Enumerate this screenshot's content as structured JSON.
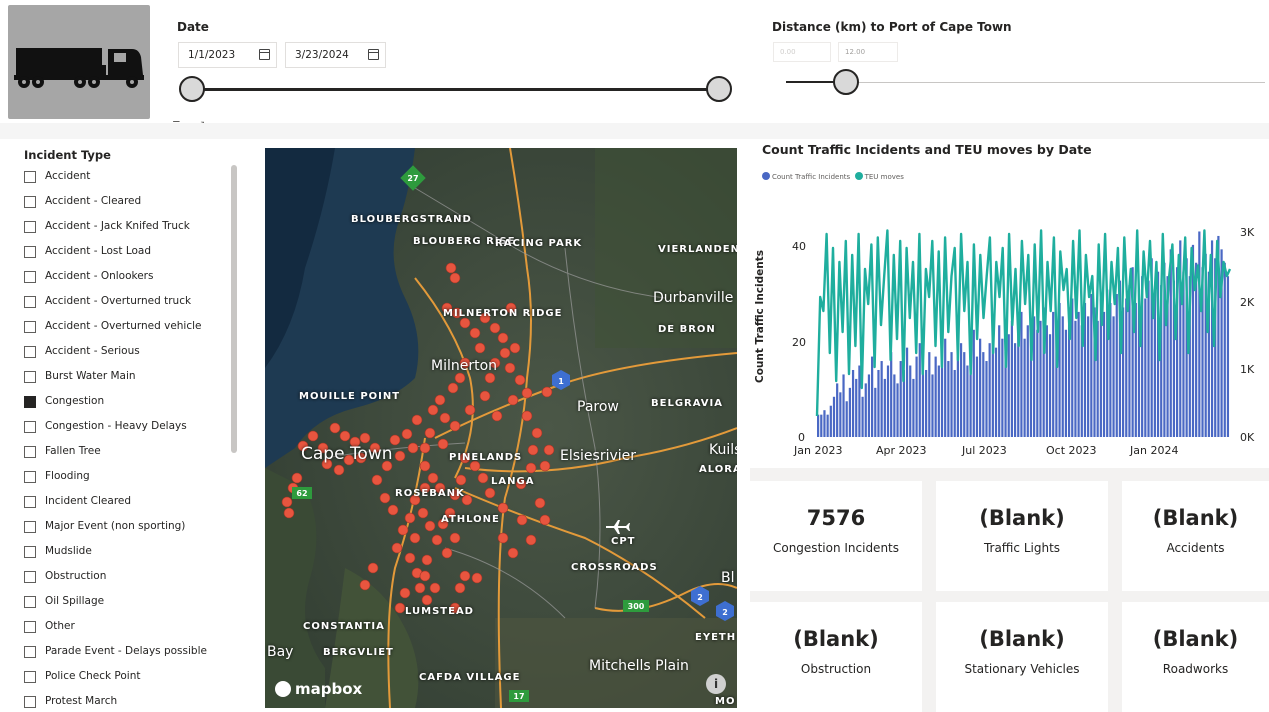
{
  "date_slicer": {
    "title": "Date",
    "start": "1/1/2023",
    "end": "3/23/2024"
  },
  "distance_slicer": {
    "title": "Distance (km) to Port of Cape Town",
    "min_value": "0.00",
    "max_value": "12.00"
  },
  "toolbar": {
    "filter": "⊽",
    "focus": "⤢",
    "more": "···"
  },
  "incident_panel": {
    "title": "Incident Type",
    "items": [
      {
        "label": "Accident",
        "checked": false
      },
      {
        "label": "Accident - Cleared",
        "checked": false
      },
      {
        "label": "Accident - Jack Knifed Truck",
        "checked": false
      },
      {
        "label": "Accident - Lost Load",
        "checked": false
      },
      {
        "label": "Accident - Onlookers",
        "checked": false
      },
      {
        "label": "Accident - Overturned truck",
        "checked": false
      },
      {
        "label": "Accident - Overturned vehicle",
        "checked": false
      },
      {
        "label": "Accident - Serious",
        "checked": false
      },
      {
        "label": "Burst Water Main",
        "checked": false
      },
      {
        "label": "Congestion",
        "checked": true
      },
      {
        "label": "Congestion - Heavy Delays",
        "checked": false
      },
      {
        "label": "Fallen Tree",
        "checked": false
      },
      {
        "label": "Flooding",
        "checked": false
      },
      {
        "label": "Incident Cleared",
        "checked": false
      },
      {
        "label": "Major Event (non sporting)",
        "checked": false
      },
      {
        "label": "Mudslide",
        "checked": false
      },
      {
        "label": "Obstruction",
        "checked": false
      },
      {
        "label": "Oil Spillage",
        "checked": false
      },
      {
        "label": "Other",
        "checked": false
      },
      {
        "label": "Parade Event - Delays possible",
        "checked": false
      },
      {
        "label": "Police Check Point",
        "checked": false
      },
      {
        "label": "Protest March",
        "checked": false
      }
    ]
  },
  "map": {
    "labels": [
      "BLOUBERGSTRAND",
      "BLOUBERG RISE",
      "RACING PARK",
      "VIERLANDEN",
      "Durbanville",
      "DE BRON",
      "MILNERTON RIDGE",
      "Milnerton",
      "MOUILLE POINT",
      "Cape Town",
      "Parow",
      "BELGRAVIA",
      "Elsiesrivier",
      "PINELANDS",
      "LANGA",
      "ROSEBANK",
      "ATHLONE",
      "CPT",
      "CROSSROADS",
      "CONSTANTIA",
      "BERGVLIET",
      "LUMSTEAD",
      "CAFDA VILLAGE",
      "Mitchells Plain",
      "Kuils",
      "ALORA",
      "Bay",
      "Bl",
      "EYETH",
      "MO"
    ],
    "shields": [
      "27",
      "1",
      "62",
      "300",
      "2",
      "2",
      "17"
    ],
    "logo": "mapbox",
    "info": "i"
  },
  "chart": {
    "title": "Count Traffic Incidents and TEU moves by Date",
    "ylabel_left": "Count Traffic Incidents",
    "legend": [
      "Count Traffic Incidents",
      "TEU moves"
    ],
    "colors": {
      "incidents": "#4a68c4",
      "teu": "#1fae9e"
    }
  },
  "chart_data": {
    "type": "bar",
    "title": "Count Traffic Incidents and TEU moves by Date",
    "xlabel": "",
    "ylabel": "Count Traffic Incidents",
    "x_ticks": [
      "Jan 2023",
      "Apr 2023",
      "Jul 2023",
      "Oct 2023",
      "Jan 2024"
    ],
    "y_left_ticks": [
      "0",
      "20",
      "40"
    ],
    "y_right_ticks": [
      "0K",
      "1K",
      "2K",
      "3K"
    ],
    "ylim_left": [
      0,
      47
    ],
    "ylim_right": [
      0,
      3000
    ],
    "series": [
      {
        "name": "Count Traffic Incidents",
        "kind": "bar",
        "axis": "left",
        "start": "2023-01-03",
        "end": "2024-03-23",
        "values": [
          5,
          5,
          6,
          5,
          7,
          9,
          12,
          10,
          14,
          8,
          11,
          15,
          13,
          16,
          9,
          12,
          14,
          18,
          11,
          15,
          17,
          13,
          16,
          19,
          14,
          12,
          17,
          15,
          20,
          16,
          13,
          18,
          21,
          17,
          15,
          19,
          14,
          18,
          16,
          20,
          22,
          17,
          19,
          15,
          18,
          21,
          19,
          16,
          20,
          24,
          18,
          22,
          19,
          17,
          21,
          23,
          20,
          25,
          22,
          19,
          23,
          26,
          21,
          24,
          28,
          22,
          25,
          23,
          27,
          24,
          26,
          29,
          25,
          23,
          28,
          26,
          30,
          27,
          24,
          29,
          31,
          26,
          28,
          25,
          30,
          27,
          32,
          29,
          26,
          31,
          28,
          33,
          30,
          27,
          32,
          35,
          29,
          31,
          34,
          38,
          30,
          33,
          36,
          31,
          35,
          40,
          33,
          37,
          34,
          39,
          36,
          42,
          35,
          38,
          44,
          37,
          40,
          36,
          43,
          39,
          46,
          38,
          41,
          37,
          44,
          40,
          45,
          42,
          39,
          36
        ]
      },
      {
        "name": "TEU moves",
        "kind": "line",
        "axis": "right",
        "start": "2023-01-03",
        "end": "2024-03-23",
        "values": [
          300,
          2000,
          1800,
          2900,
          1200,
          2700,
          800,
          2500,
          1500,
          2800,
          900,
          2600,
          1300,
          2900,
          700,
          2400,
          1900,
          2750,
          1000,
          2850,
          1600,
          2300,
          2950,
          1100,
          2600,
          1400,
          2800,
          800,
          2700,
          1700,
          2500,
          1200,
          2900,
          900,
          2400,
          2000,
          2800,
          1300,
          2650,
          1000,
          2850,
          1500,
          2300,
          2700,
          1100,
          2900,
          1800,
          2500,
          900,
          2750,
          1400,
          2600,
          1700,
          2300,
          2850,
          1200,
          2500,
          2000,
          2700,
          1000,
          2900,
          1600,
          2400,
          1300,
          2800,
          1900,
          2600,
          1100,
          2750,
          1500,
          2950,
          1200,
          2500,
          1800,
          2850,
          1000,
          2650,
          2100,
          2400,
          1400,
          2800,
          1700,
          2950,
          1300,
          2600,
          2000,
          2300,
          1100,
          2750,
          1600,
          2900,
          1400,
          2500,
          1900,
          2700,
          1200,
          2850,
          1800,
          2400,
          1500,
          2950,
          1300,
          2650,
          2000,
          2800,
          1700,
          2500,
          1100,
          2900,
          1600,
          2300,
          2750,
          1400,
          2600,
          1900,
          2850,
          1200,
          2700,
          2100,
          2450,
          1800,
          2950,
          1500,
          2600,
          1300,
          2800,
          2000,
          2500,
          2300,
          2400
        ]
      }
    ]
  },
  "kpis": [
    {
      "value": "7576",
      "caption": "Congestion Incidents"
    },
    {
      "value": "(Blank)",
      "caption": "Traffic Lights"
    },
    {
      "value": "(Blank)",
      "caption": "Accidents"
    },
    {
      "value": "(Blank)",
      "caption": "Obstruction"
    },
    {
      "value": "(Blank)",
      "caption": "Stationary Vehicles"
    },
    {
      "value": "(Blank)",
      "caption": "Roadworks"
    }
  ]
}
